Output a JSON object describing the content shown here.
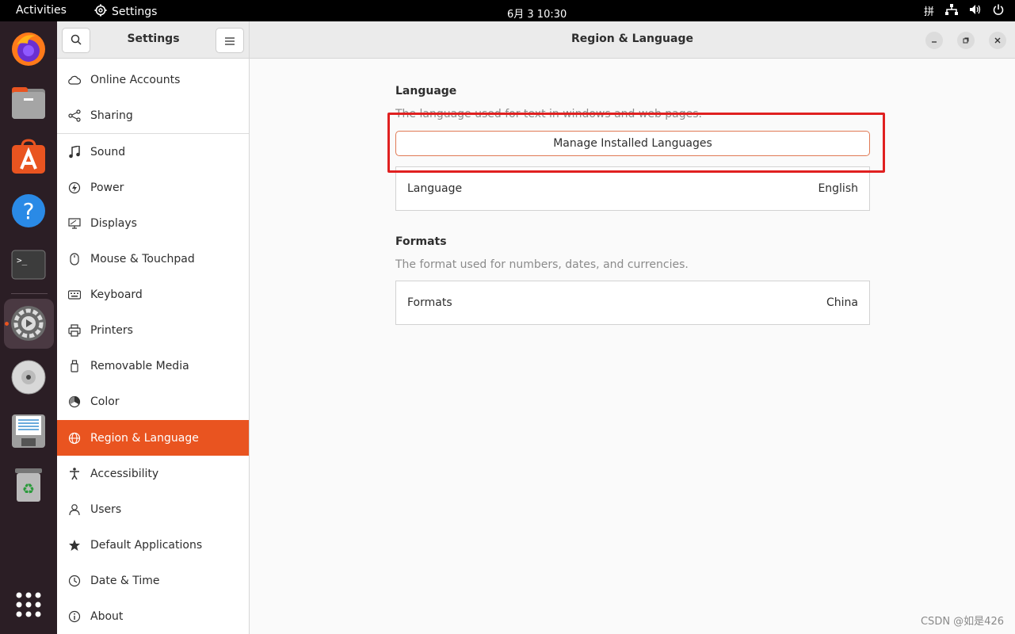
{
  "topbar": {
    "activities": "Activities",
    "app_name": "Settings",
    "clock": "6月 3  10:30",
    "input_method": "拼"
  },
  "sidebar": {
    "title": "Settings",
    "items": [
      {
        "label": "Online Accounts",
        "icon": "cloud-icon"
      },
      {
        "label": "Sharing",
        "icon": "share-icon"
      },
      {
        "label": "Sound",
        "icon": "music-note-icon"
      },
      {
        "label": "Power",
        "icon": "power-icon"
      },
      {
        "label": "Displays",
        "icon": "display-icon"
      },
      {
        "label": "Mouse & Touchpad",
        "icon": "mouse-icon"
      },
      {
        "label": "Keyboard",
        "icon": "keyboard-icon"
      },
      {
        "label": "Printers",
        "icon": "printer-icon"
      },
      {
        "label": "Removable Media",
        "icon": "removable-media-icon"
      },
      {
        "label": "Color",
        "icon": "color-icon"
      },
      {
        "label": "Region & Language",
        "icon": "globe-icon",
        "selected": true
      },
      {
        "label": "Accessibility",
        "icon": "accessibility-icon"
      },
      {
        "label": "Users",
        "icon": "users-icon"
      },
      {
        "label": "Default Applications",
        "icon": "star-icon"
      },
      {
        "label": "Date & Time",
        "icon": "clock-icon"
      },
      {
        "label": "About",
        "icon": "info-icon"
      }
    ]
  },
  "main": {
    "title": "Region & Language",
    "language_section": {
      "title": "Language",
      "description": "The language used for text in windows and web pages.",
      "manage_button": "Manage Installed Languages",
      "row_label": "Language",
      "row_value": "English"
    },
    "formats_section": {
      "title": "Formats",
      "description": "The format used for numbers, dates, and currencies.",
      "row_label": "Formats",
      "row_value": "China"
    }
  },
  "watermark": "CSDN @如是426",
  "colors": {
    "accent": "#e95420",
    "highlight": "#e02020",
    "dock_bg": "#2b1e25"
  }
}
